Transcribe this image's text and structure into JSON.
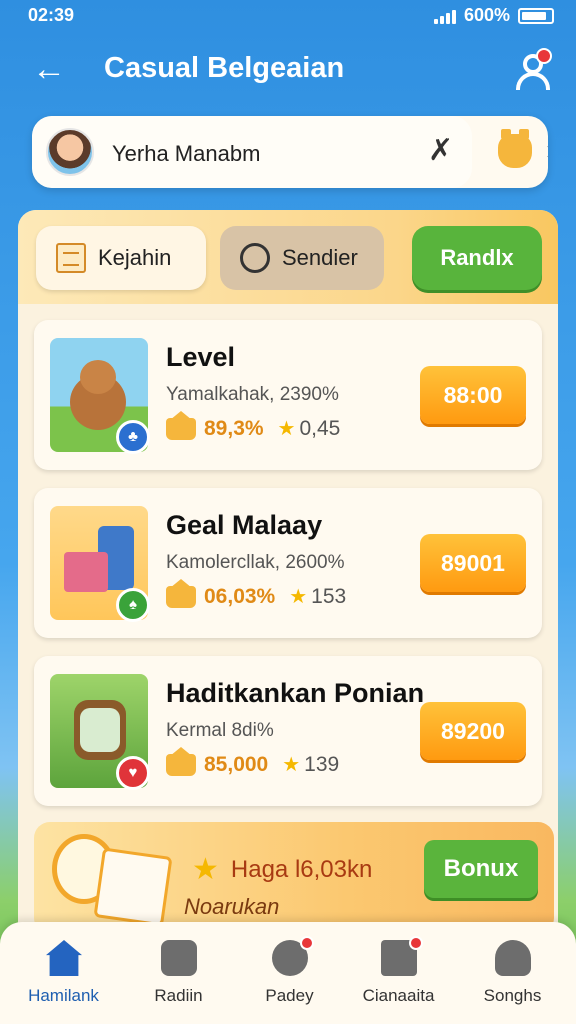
{
  "status": {
    "time": "02:39",
    "battery": "600%"
  },
  "header": {
    "title": "Casual Belgeaian",
    "back_glyph": "←"
  },
  "user": {
    "name": "Yerha Manabm",
    "clear_glyph": "✗",
    "chevron_glyph": "›"
  },
  "tabs": [
    {
      "label": "Kejahin"
    },
    {
      "label": "Sendier"
    },
    {
      "label": "Randlx"
    }
  ],
  "items": [
    {
      "title": "Level",
      "subtitle": "Yamalkahak, 2390%",
      "stat_primary": "89,3%",
      "stat_secondary": "0,45",
      "price": "88:00"
    },
    {
      "title": "Geal Malaay",
      "subtitle": "Kamolercllak, 2600%",
      "stat_primary": "06,03%",
      "stat_secondary": "153",
      "price": "89001"
    },
    {
      "title": "Haditkankan Ponian",
      "subtitle": "Kermal 8di%",
      "stat_primary": "85,000",
      "stat_secondary": "139",
      "price": "89200"
    }
  ],
  "bonus": {
    "title": "Haga l6,03kn",
    "subtitle": "Noarukan",
    "button": "Bonux"
  },
  "nav": [
    {
      "label": "Hamilank"
    },
    {
      "label": "Radiin"
    },
    {
      "label": "Padey"
    },
    {
      "label": "Cianaaita"
    },
    {
      "label": "Songhs"
    }
  ],
  "colors": {
    "accent": "#2f8fe0",
    "price_orange": "#ff9a10",
    "green": "#58b43c"
  }
}
